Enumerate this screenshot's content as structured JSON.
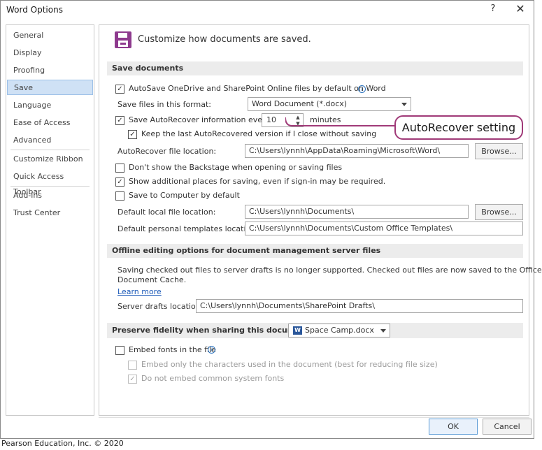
{
  "window": {
    "title": "Word Options",
    "help": "?",
    "close": "✕"
  },
  "sidebar": {
    "items": [
      {
        "label": "General"
      },
      {
        "label": "Display"
      },
      {
        "label": "Proofing"
      },
      {
        "label": "Save"
      },
      {
        "label": "Language"
      },
      {
        "label": "Ease of Access"
      },
      {
        "label": "Advanced"
      },
      {
        "label": "Customize Ribbon"
      },
      {
        "label": "Quick Access Toolbar"
      },
      {
        "label": "Add-ins"
      },
      {
        "label": "Trust Center"
      }
    ],
    "selected": "Save"
  },
  "main": {
    "heading": "Customize how documents are saved.",
    "save_documents": {
      "title": "Save documents",
      "autosave": {
        "label": "AutoSave OneDrive and SharePoint Online files by default on Word",
        "checked": true
      },
      "format_label": "Save files in this format:",
      "format_value": "Word Document (*.docx)",
      "autorecover": {
        "label": "Save AutoRecover information every",
        "checked": true
      },
      "autorecover_minutes": "10",
      "minutes_label": "minutes",
      "keep_last": {
        "label": "Keep the last AutoRecovered version if I close without saving",
        "checked": true
      },
      "autorecover_location_label": "AutoRecover file location:",
      "autorecover_location_value": "C:\\Users\\lynnh\\AppData\\Roaming\\Microsoft\\Word\\",
      "browse1": "Browse...",
      "backstage": {
        "label": "Don't show the Backstage when opening or saving files",
        "checked": false
      },
      "additional_places": {
        "label": "Show additional places for saving, even if sign-in may be required.",
        "checked": true
      },
      "save_to_computer": {
        "label": "Save to Computer by default",
        "checked": false
      },
      "local_location_label": "Default local file location:",
      "local_location_value": "C:\\Users\\lynnh\\Documents\\",
      "browse2": "Browse...",
      "templates_label": "Default personal templates location:",
      "templates_value": "C:\\Users\\lynnh\\Documents\\Custom Office Templates\\"
    },
    "offline": {
      "title": "Offline editing options for document management server files",
      "text_line1": "Saving checked out files to server drafts is no longer supported. Checked out files are now saved to the Office",
      "text_line2": "Document Cache.",
      "learn_more": "Learn more",
      "drafts_label": "Server drafts location:",
      "drafts_value": "C:\\Users\\lynnh\\Documents\\SharePoint Drafts\\"
    },
    "fidelity": {
      "title": "Preserve fidelity when sharing this document:",
      "document": "Space Camp.docx",
      "embed_fonts": {
        "label": "Embed fonts in the file",
        "checked": false
      },
      "embed_only": {
        "label": "Embed only the characters used in the document (best for reducing file size)",
        "checked": false
      },
      "no_common": {
        "label": "Do not embed common system fonts",
        "checked": true
      }
    }
  },
  "buttons": {
    "ok": "OK",
    "cancel": "Cancel"
  },
  "callout": "AutoRecover setting",
  "credit": "Pearson Education, Inc. © 2020",
  "colors": {
    "accent": "#8e3a8e",
    "callout_border": "#a03a78",
    "selected_nav": "#cfe1f5",
    "link": "#1e5bb8"
  }
}
